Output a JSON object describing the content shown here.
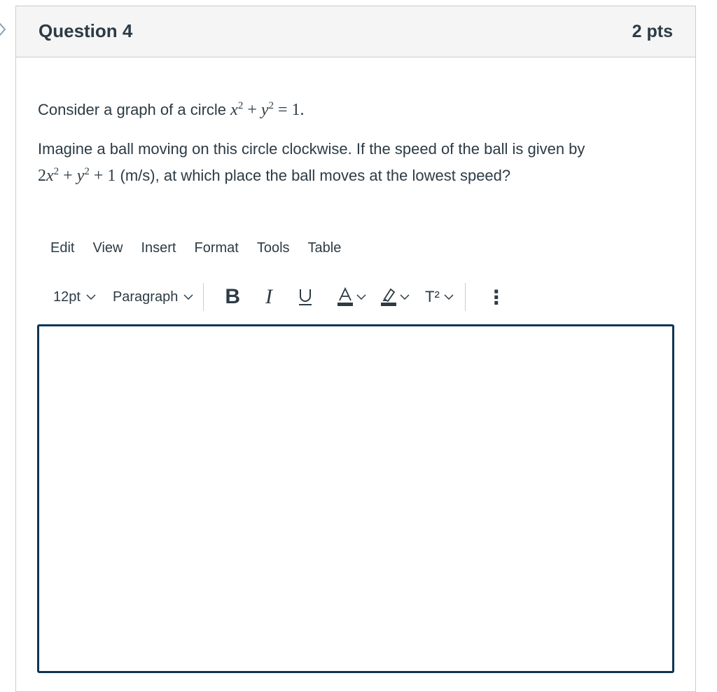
{
  "question": {
    "title": "Question 4",
    "points": "2 pts"
  },
  "body": {
    "line1_prefix": "Consider a graph of a circle",
    "line1_math": {
      "base1": "x",
      "exp1": "2",
      "plus": "+",
      "base2": "y",
      "exp2": "2",
      "eq": "= 1."
    },
    "line2_text": "Imagine a ball moving on this circle clockwise. If the speed of the ball is given by",
    "line3_math": {
      "coef": "2",
      "base1": "x",
      "exp1": "2",
      "plus1": "+",
      "base2": "y",
      "exp2": "2",
      "tail": "+ 1"
    },
    "line3_suffix": "(m/s), at which place the ball moves at the lowest speed?"
  },
  "editor": {
    "menu": [
      "Edit",
      "View",
      "Insert",
      "Format",
      "Tools",
      "Table"
    ],
    "font_size": "12pt",
    "block_format": "Paragraph",
    "bold_label": "B",
    "italic_label": "I",
    "underline_label": "U",
    "text_color_label": "A",
    "superscript_label": "T²",
    "more_label": "⋮",
    "content": ""
  },
  "colors": {
    "text": "#2d3b45",
    "border": "#c7cdd1",
    "header_bg": "#f5f5f5",
    "editor_border": "#0e3553",
    "chevron": "#8aa1b1"
  },
  "icons": [
    "chevron-right-icon",
    "chevron-down-icon",
    "text-color-icon",
    "highlight-icon",
    "more-vertical-icon"
  ]
}
